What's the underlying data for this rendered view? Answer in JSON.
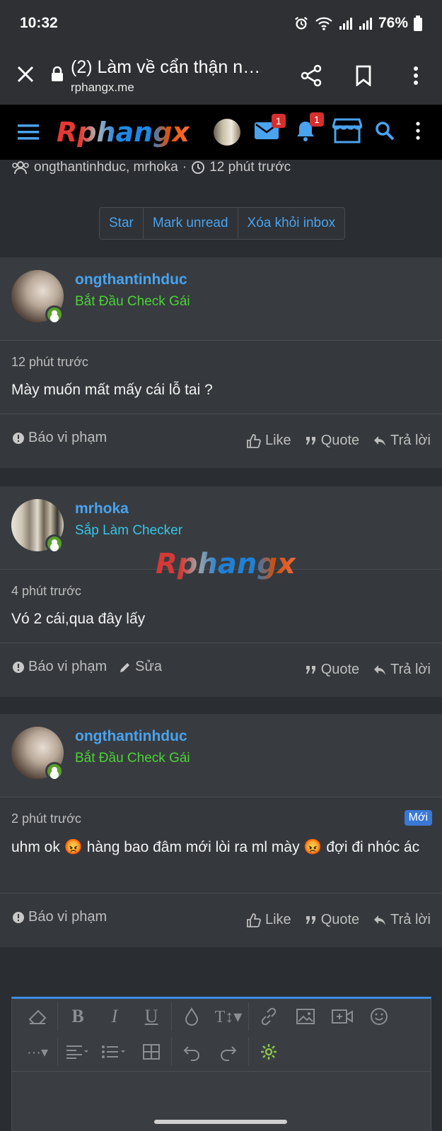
{
  "status_bar": {
    "time": "10:32",
    "battery": "76%"
  },
  "browser": {
    "title": "(2) Làm về cẩn thận nh...",
    "url": "rphangx.me"
  },
  "site": {
    "logo": "Rphangx",
    "inbox_badge": "1",
    "alerts_badge": "1"
  },
  "thread": {
    "participants": "ongthantinhduc, mrhoka",
    "separator": "·",
    "time": "12 phút trước",
    "buttons": [
      "Star",
      "Mark unread",
      "Xóa khỏi inbox"
    ]
  },
  "messages": [
    {
      "username": "ongthantinhduc",
      "user_title": "Bắt Đầu Check Gái",
      "user_title_color": "#4cd137",
      "time": "12 phút trước",
      "text": "Mày muốn mất mấy cái lỗ tai ?",
      "report": "Báo vi phạm",
      "like": "Like",
      "quote": "Quote",
      "reply": "Trả lời"
    },
    {
      "username": "mrhoka",
      "user_title": "Sắp Làm Checker",
      "user_title_color": "#36c6e8",
      "time": "4 phút trước",
      "text": "Vó 2 cái,qua đây lấy",
      "report": "Báo vi phạm",
      "edit": "Sửa",
      "quote": "Quote",
      "reply": "Trả lời"
    },
    {
      "username": "ongthantinhduc",
      "user_title": "Bắt Đầu Check Gái",
      "user_title_color": "#4cd137",
      "time": "2 phút trước",
      "new_badge": "Mới",
      "text_part1": "uhm ok ",
      "emoji1": "😡",
      "text_part2": " hàng bao đâm mới lòi ra ml mày ",
      "emoji2": "😡",
      "text_part3": " đợi đi nhóc ác",
      "report": "Báo vi phạm",
      "like": "Like",
      "quote": "Quote",
      "reply": "Trả lời"
    }
  ],
  "watermark": "Rphangx",
  "colors": {
    "accent": "#4aa3ee",
    "badge_red": "#d32f2f",
    "online": "#5aa02c"
  }
}
